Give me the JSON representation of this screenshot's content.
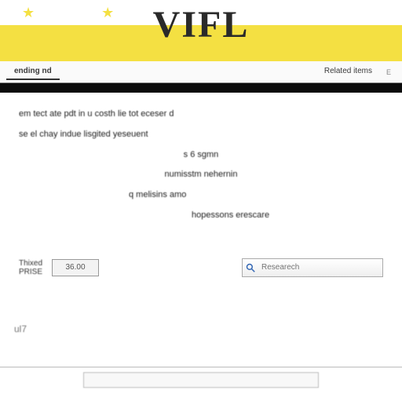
{
  "banner": {
    "logo_text": "VIFL",
    "stars": "★   ★"
  },
  "tabs": {
    "left_label": "ending nd",
    "right_label": "Related items",
    "right_hint": "E"
  },
  "body": {
    "line1": "em   tect    ate  pdt  in     u   costh     lie  tot eceser d",
    "line2": "se     el   chay  indue   lisgited    yeseuent",
    "line3": "s  6  sgmn",
    "line4": "numisstm  nehernin",
    "line5": "q  melisins     amo",
    "line6": "hopessons  erescare"
  },
  "form": {
    "label_left": "Thixed",
    "label_left2": "PRISE",
    "amount_value": "36.00",
    "search_placeholder": "Researech"
  },
  "watermark": "ul7",
  "footer_input": "                               "
}
